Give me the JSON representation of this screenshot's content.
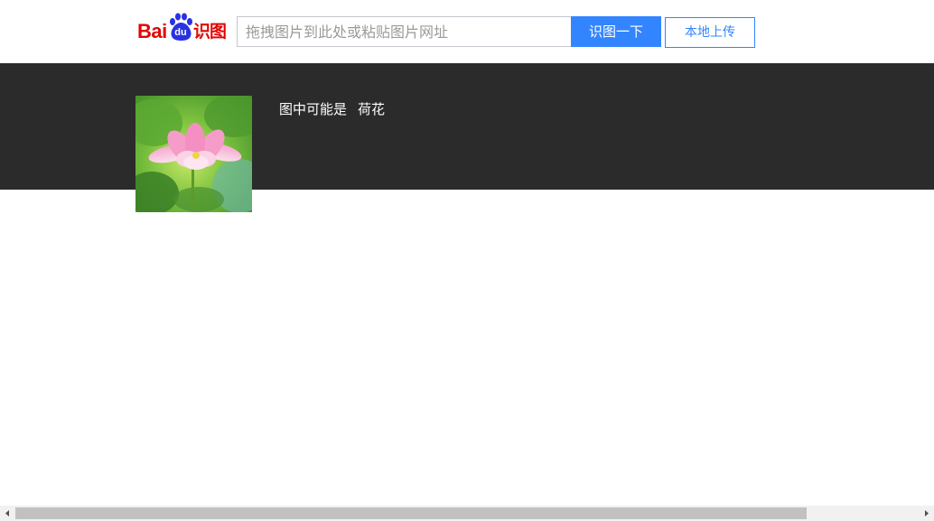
{
  "header": {
    "logo": {
      "brand": "Bai",
      "paw_text": "du",
      "product": "识图",
      "colors": {
        "brand_red": "#e10602",
        "paw_blue": "#2932e1"
      }
    },
    "search": {
      "placeholder": "拖拽图片到此处或粘贴图片网址",
      "value": ""
    },
    "identify_button": "识图一下",
    "upload_button": "本地上传"
  },
  "result": {
    "guess_prefix": "图中可能是",
    "guess_name": "荷花",
    "thumbnail_icon": "lotus-flower-image"
  },
  "scrollbar": {
    "orientation": "horizontal",
    "thumb_fraction": 0.85,
    "left_icon": "triangle-left-icon",
    "right_icon": "triangle-right-icon"
  },
  "colors": {
    "accent": "#3385ff",
    "band_bg": "#2b2b2b",
    "page_bg": "#ffffff"
  }
}
